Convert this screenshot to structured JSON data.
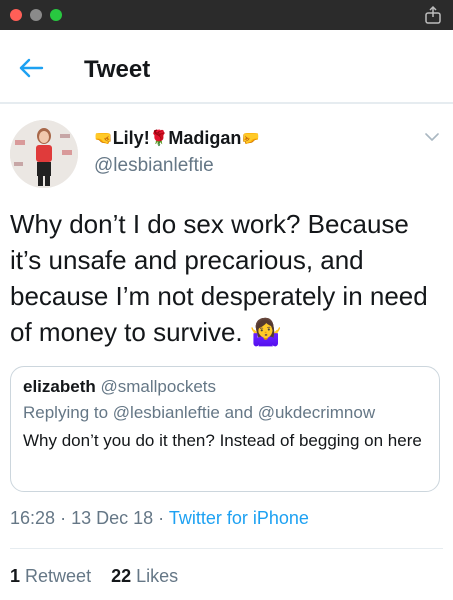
{
  "window": {
    "controls": [
      "close",
      "minimize",
      "zoom"
    ],
    "share_icon": "share-icon"
  },
  "header": {
    "back_icon": "back-arrow-icon",
    "title": "Tweet"
  },
  "author": {
    "emoji_left": "🤜",
    "name_part1": "Lily!",
    "emoji_mid": "🌹",
    "name_part2": "Madigan",
    "emoji_right": "🤛",
    "handle": "@lesbianleftie"
  },
  "tweet": {
    "text": "Why don’t I do sex work? Because it’s unsafe and precarious, and because I’m not desperately in need of money to survive.",
    "end_emoji": "🤷‍♀️"
  },
  "quote": {
    "name": "elizabeth",
    "handle": "@smallpockets",
    "reply_prefix": "Replying to",
    "reply_user1": "@lesbianleftie",
    "reply_and": "and",
    "reply_user2": "@ukdecrimnow",
    "text": "Why don’t you do it then? Instead of begging on here"
  },
  "meta": {
    "time": "16:28",
    "sep1": "·",
    "date": "13 Dec 18",
    "sep2": "·",
    "source": "Twitter for iPhone"
  },
  "stats": {
    "retweets": "1",
    "retweets_label": "Retweet",
    "likes": "22",
    "likes_label": "Likes"
  },
  "colors": {
    "accent": "#1da1f2",
    "secondary_text": "#657786",
    "border": "#e6ecf0",
    "titlebar": "#2b2b2b"
  }
}
